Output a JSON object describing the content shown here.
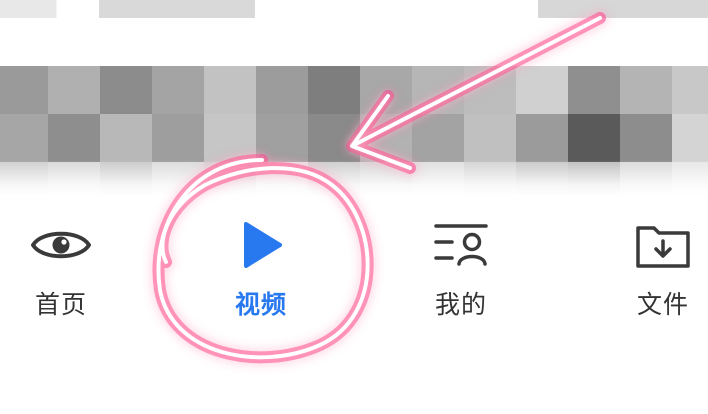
{
  "tabbar": {
    "items": [
      {
        "label": "首页",
        "icon": "eye-icon",
        "active": false
      },
      {
        "label": "视频",
        "icon": "play-icon",
        "active": true
      },
      {
        "label": "我的",
        "icon": "profile-list-icon",
        "active": false
      },
      {
        "label": "文件",
        "icon": "folder-download-icon",
        "active": false
      }
    ]
  },
  "colors": {
    "active": "#2878ef",
    "inactive_label": "#333333",
    "icon_stroke": "#3a3a3a",
    "annotation_glow": "#ff2d8a"
  }
}
